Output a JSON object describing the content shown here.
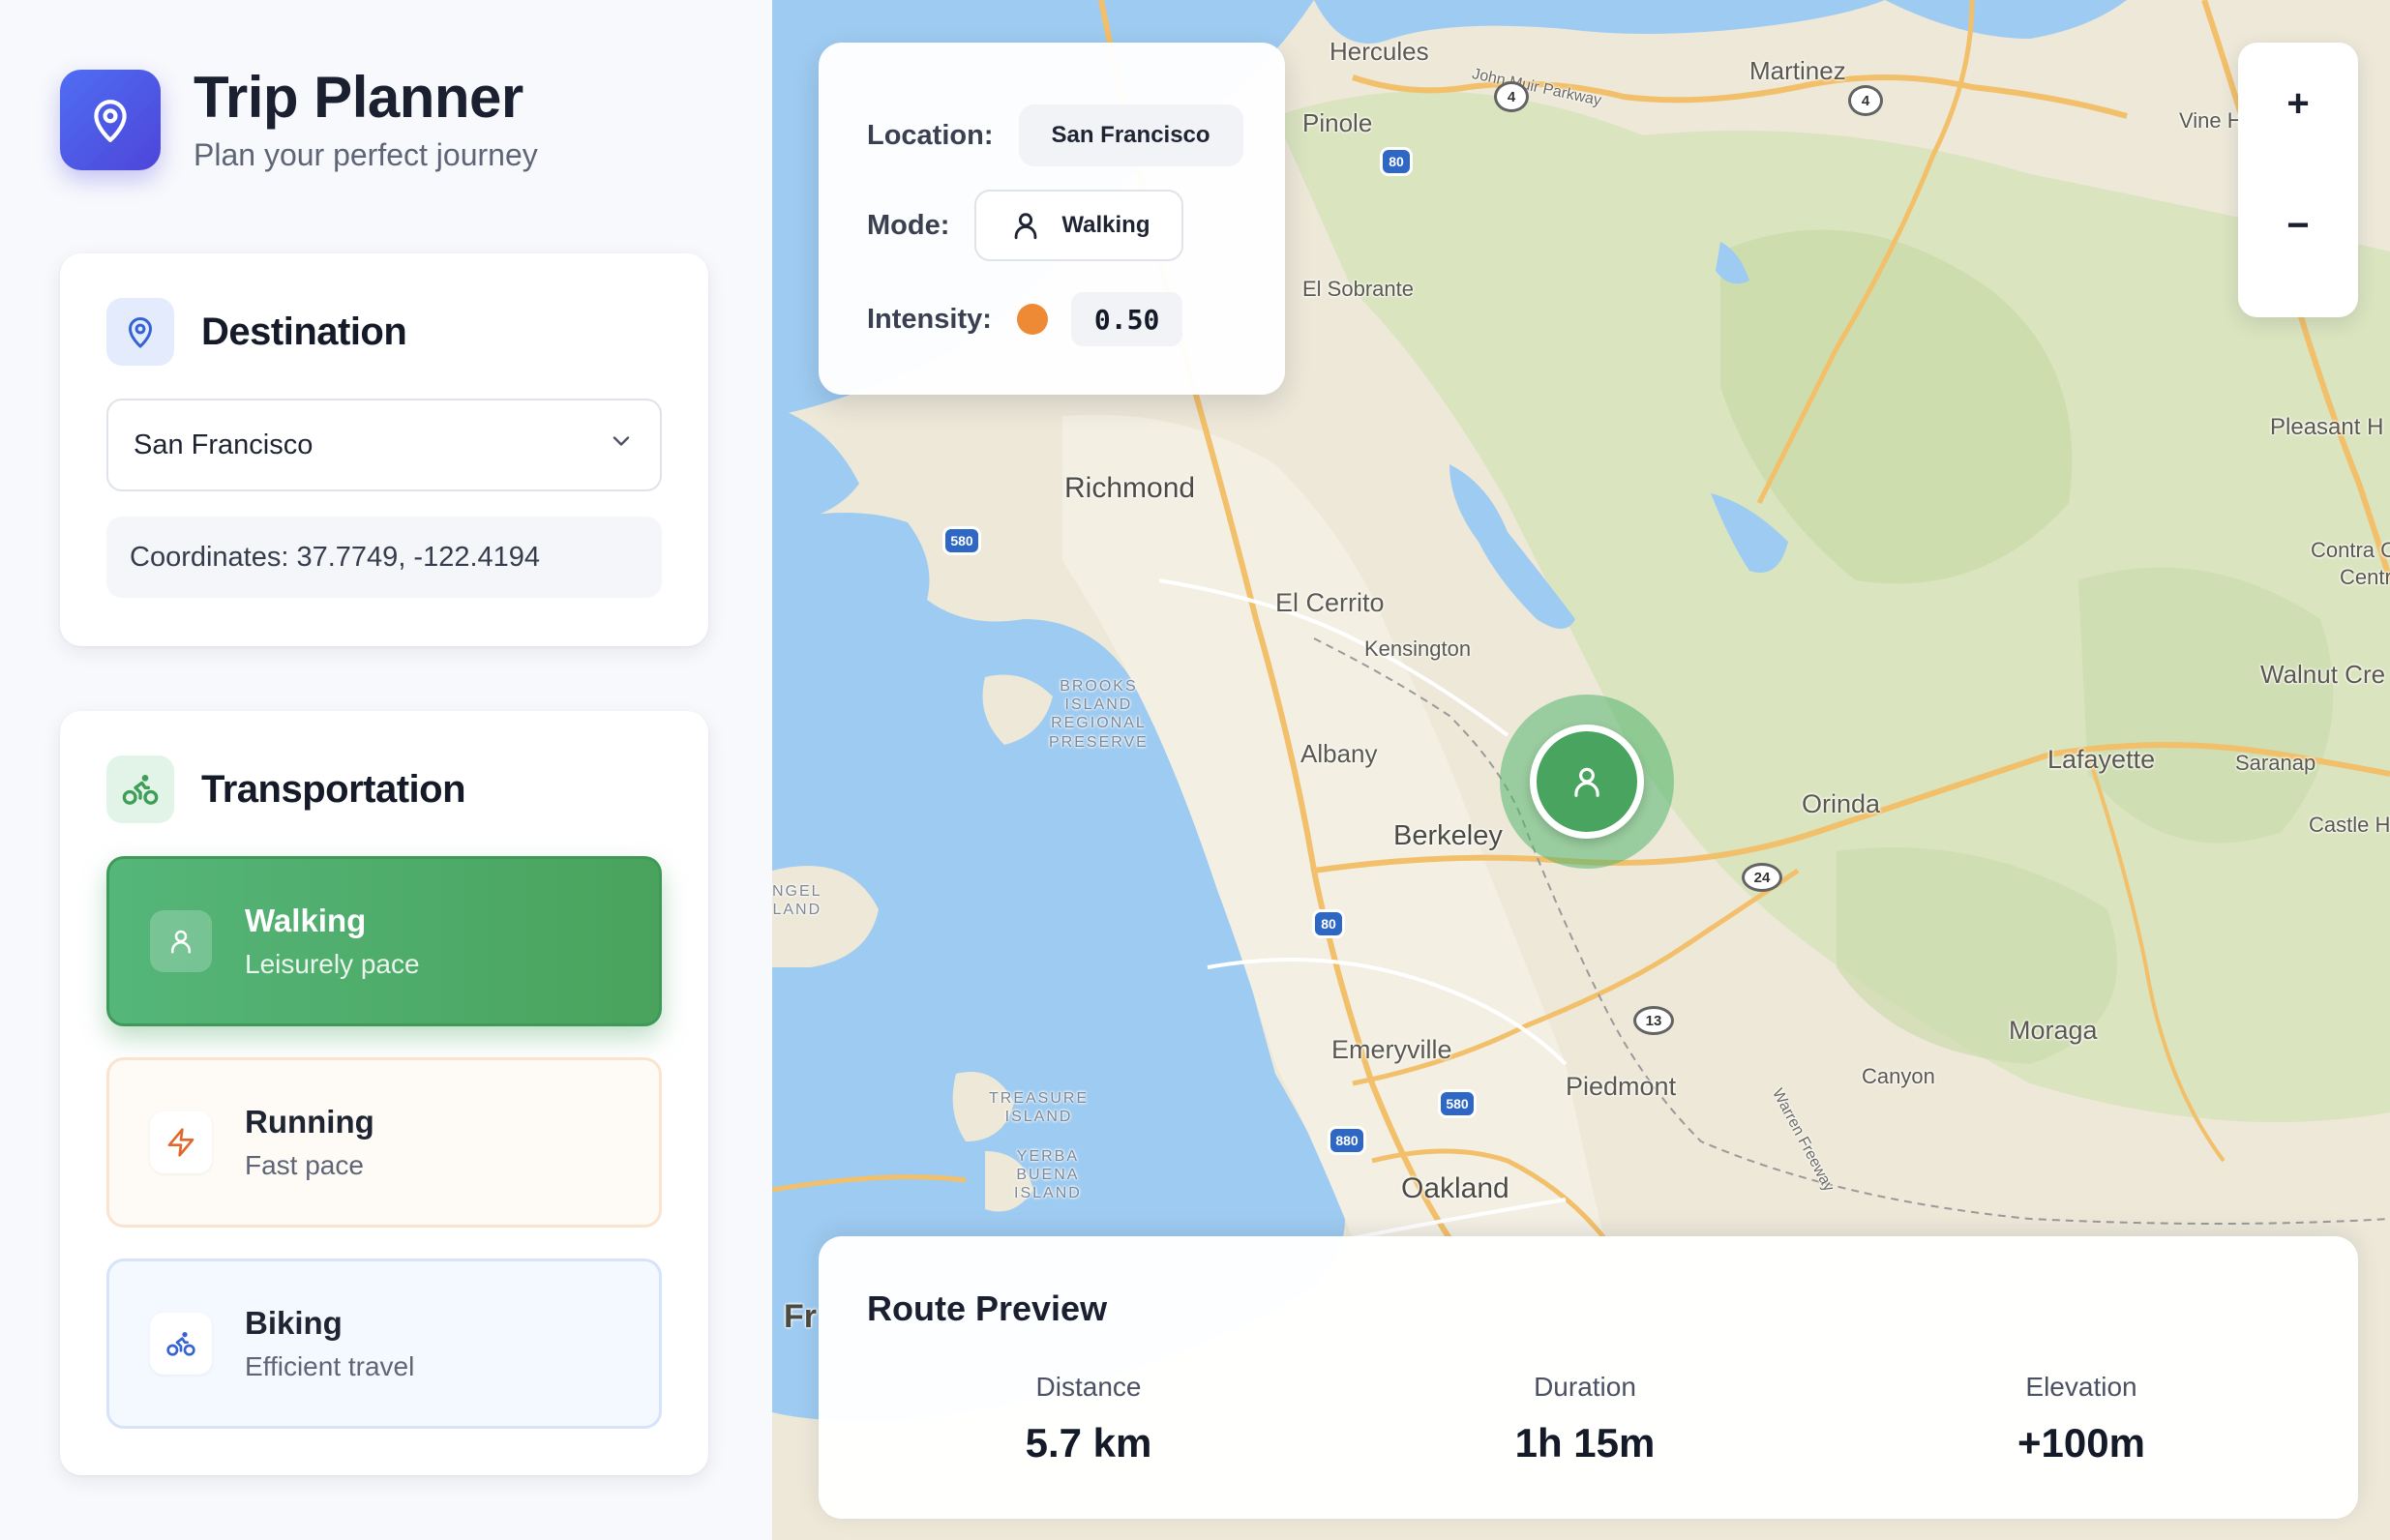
{
  "brand": {
    "title": "Trip Planner",
    "subtitle": "Plan your perfect journey",
    "icon": "map-pin-icon"
  },
  "destination": {
    "title": "Destination",
    "selected": "San Francisco",
    "coordinates": "Coordinates: 37.7749, -122.4194"
  },
  "transportation": {
    "title": "Transportation",
    "modes": [
      {
        "name": "Walking",
        "desc": "Leisurely pace",
        "icon": "person-icon",
        "selected": true,
        "color": "#4caf64"
      },
      {
        "name": "Running",
        "desc": "Fast pace",
        "icon": "lightning-icon",
        "selected": false,
        "color": "#e2672a"
      },
      {
        "name": "Biking",
        "desc": "Efficient travel",
        "icon": "bicycle-icon",
        "selected": false,
        "color": "#3563d6"
      }
    ]
  },
  "info": {
    "location_label": "Location:",
    "location_value": "San Francisco",
    "mode_label": "Mode:",
    "mode_value": "Walking",
    "intensity_label": "Intensity:",
    "intensity_value": "0.50",
    "intensity_color": "#ee8a35"
  },
  "zoom": {
    "in": "+",
    "out": "−"
  },
  "route": {
    "title": "Route Preview",
    "stats": [
      {
        "label": "Distance",
        "value": "5.7 km"
      },
      {
        "label": "Duration",
        "value": "1h 15m"
      },
      {
        "label": "Elevation",
        "value": "+100m"
      }
    ]
  },
  "map": {
    "labels": {
      "hercules": "Hercules",
      "martinez": "Martinez",
      "pinole": "Pinole",
      "vine_hill": "Vine H",
      "el_sobrante": "El Sobrante",
      "richmond": "Richmond",
      "el_cerrito": "El Cerrito",
      "kensington": "Kensington",
      "albany": "Albany",
      "berkeley": "Berkeley",
      "orinda": "Orinda",
      "lafayette": "Lafayette",
      "saranap": "Saranap",
      "castle_hill": "Castle H",
      "pleasant_hill": "Pleasant H",
      "contra_costa": "Contra C",
      "centre": "Centr",
      "walnut_creek": "Walnut Cre",
      "moraga": "Moraga",
      "canyon": "Canyon",
      "emeryville": "Emeryville",
      "piedmont": "Piedmont",
      "oakland": "Oakland",
      "fr": "Fr",
      "john_muir": "John Muir Parkway",
      "warren": "Warren Freeway",
      "brooks": "BROOKS\nISLAND\nREGIONAL\nPRESERVE",
      "treasure": "TREASURE\nISLAND",
      "yerba": "YERBA\nBUENA\nISLAND",
      "angel": "NGEL\nLAND"
    },
    "shields": {
      "i80": "80",
      "i580": "580",
      "i880": "880",
      "ca4": "4",
      "ca24": "24",
      "ca13": "13"
    }
  }
}
